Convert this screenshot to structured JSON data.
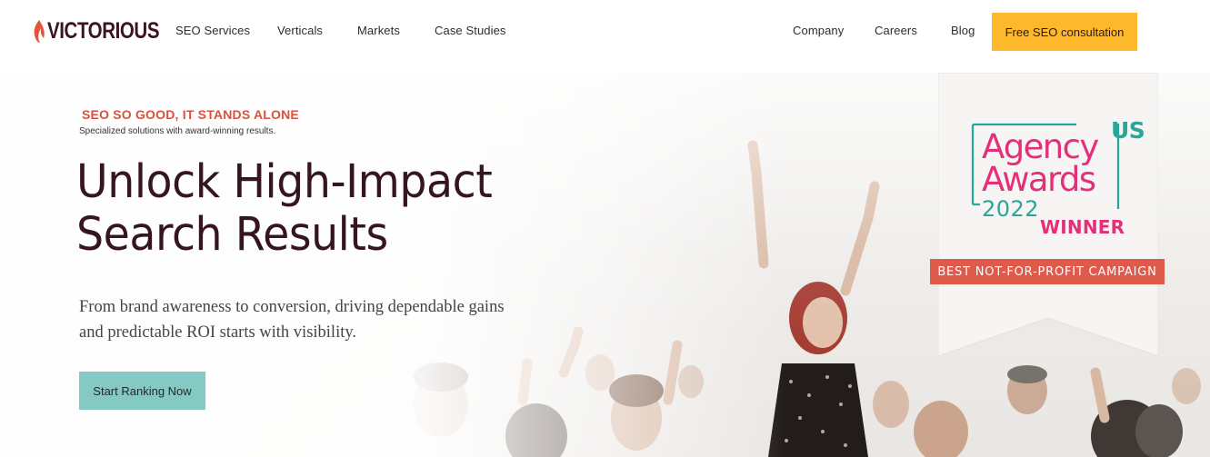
{
  "brand": {
    "name": "VICTORIOUS"
  },
  "nav": {
    "left_links": [
      "SEO Services",
      "Verticals",
      "Markets",
      "Case Studies"
    ],
    "right_links": [
      "Company",
      "Careers",
      "Blog"
    ],
    "cta_label": "Free SEO consultation"
  },
  "hero": {
    "eyebrow": "SEO SO GOOD, IT STANDS ALONE",
    "sub_eyebrow": "Specialized solutions with award-winning results.",
    "headline_line1": "Unlock High-Impact",
    "headline_line2": "Search Results",
    "lead_line1": "From brand awareness to conversion, driving dependable gains",
    "lead_line2": "and predictable ROI starts with visibility.",
    "cta_label": "Start Ranking Now"
  },
  "award": {
    "us": "US",
    "agency": "Agency",
    "awards": "Awards",
    "year": "2022",
    "winner": "WINNER",
    "category": "BEST NOT-FOR-PROFIT CAMPAIGN"
  },
  "colors": {
    "brand": "#3b1422",
    "accent_yellow": "#fdb92b",
    "accent_teal": "#85c9c4",
    "eyebrow_red": "#d9523d",
    "award_pink": "#e4307a",
    "award_teal": "#2aa59a",
    "ribbon_red": "#df5a4b"
  }
}
